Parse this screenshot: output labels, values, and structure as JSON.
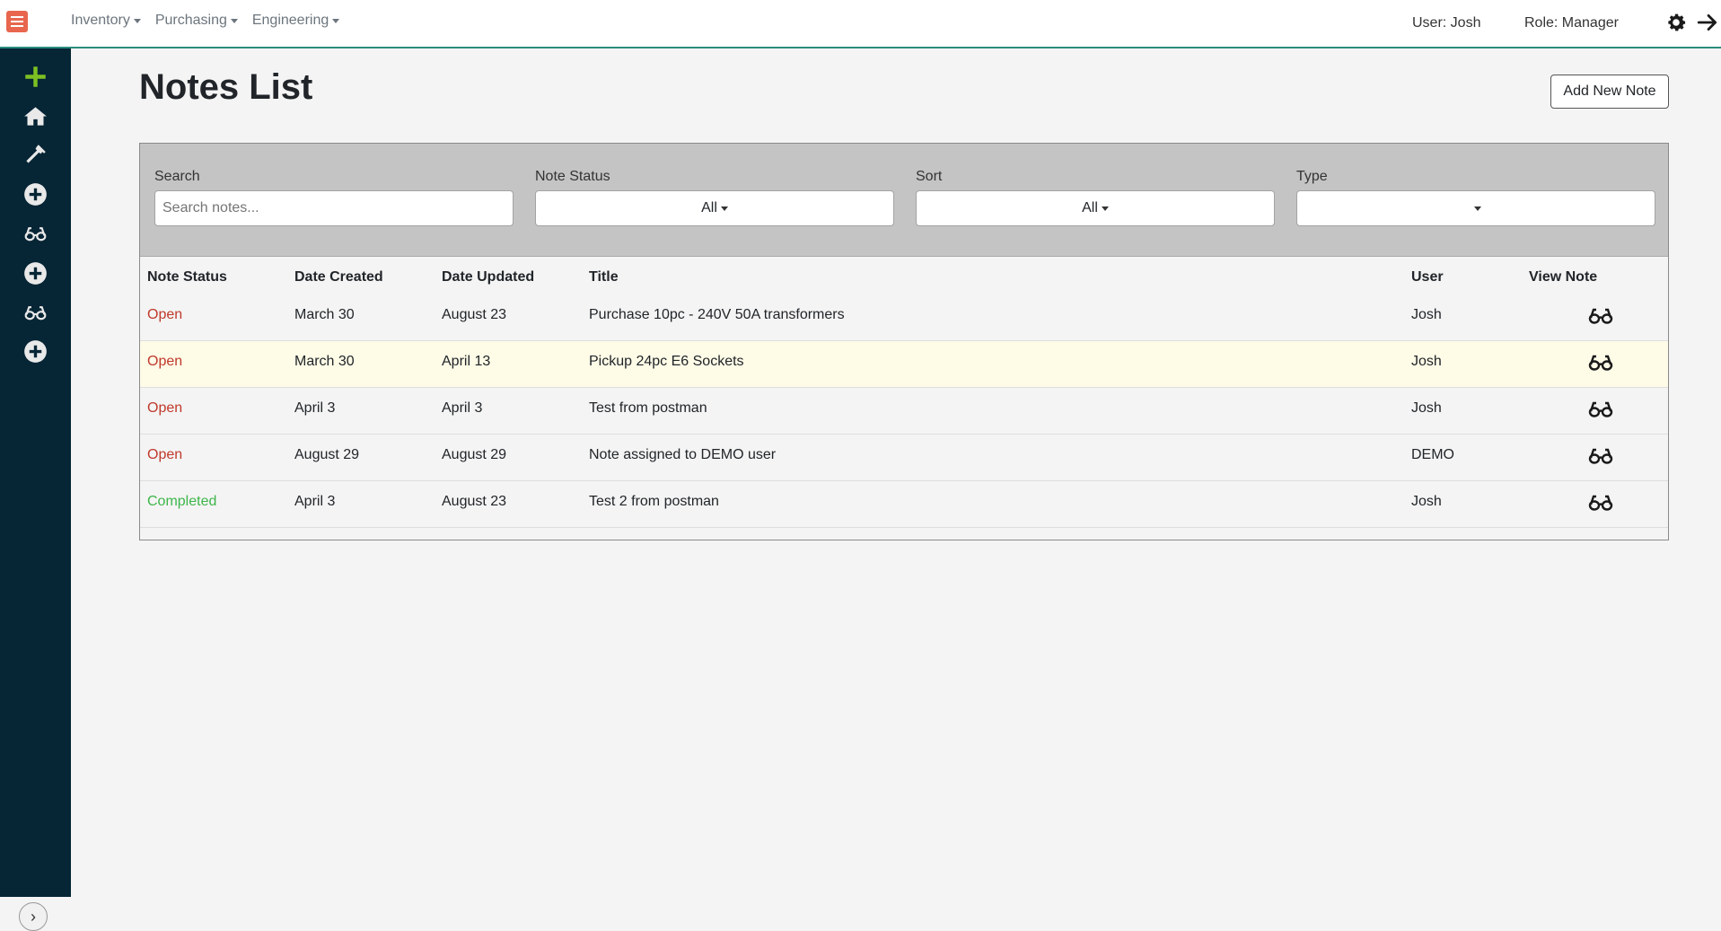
{
  "nav": {
    "menu": [
      {
        "label": "Inventory"
      },
      {
        "label": "Purchasing"
      },
      {
        "label": "Engineering"
      }
    ],
    "user": "User: Josh",
    "role": "Role: Manager"
  },
  "icons": {
    "menu": "hamburger-icon",
    "settings": "gear-icon",
    "logout": "arrow-right-icon",
    "sidebar": [
      "plus-icon",
      "home-icon",
      "hammer-icon",
      "plus-circle-icon",
      "glasses-icon",
      "plus-circle-icon",
      "glasses-icon",
      "plus-circle-icon"
    ],
    "expand": "chevron-right-icon",
    "view": "glasses-icon"
  },
  "colors": {
    "accent": "#2a8c7c",
    "sidebar_bg": "#062535",
    "menu_icon": "#e8664e",
    "add_icon": "#7cc022",
    "status_open": "#c0392b",
    "status_completed": "#3db64a"
  },
  "page": {
    "title": "Notes List",
    "add_button": "Add New Note"
  },
  "filters": {
    "search_label": "Search",
    "search_placeholder": "Search notes...",
    "status_label": "Note Status",
    "status_value": "All",
    "sort_label": "Sort",
    "sort_value": "All",
    "type_label": "Type",
    "type_value": ""
  },
  "table": {
    "headers": [
      "Note Status",
      "Date Created",
      "Date Updated",
      "Title",
      "User",
      "View Note"
    ],
    "rows": [
      {
        "status": "Open",
        "created": "March 30",
        "updated": "August 23",
        "title": "Purchase 10pc - 240V 50A transformers",
        "user": "Josh"
      },
      {
        "status": "Open",
        "created": "March 30",
        "updated": "April 13",
        "title": "Pickup 24pc E6 Sockets",
        "user": "Josh"
      },
      {
        "status": "Open",
        "created": "April 3",
        "updated": "April 3",
        "title": "Test from postman",
        "user": "Josh"
      },
      {
        "status": "Open",
        "created": "August 29",
        "updated": "August 29",
        "title": "Note assigned to DEMO user",
        "user": "DEMO"
      },
      {
        "status": "Completed",
        "created": "April 3",
        "updated": "August 23",
        "title": "Test 2 from postman",
        "user": "Josh"
      }
    ]
  }
}
